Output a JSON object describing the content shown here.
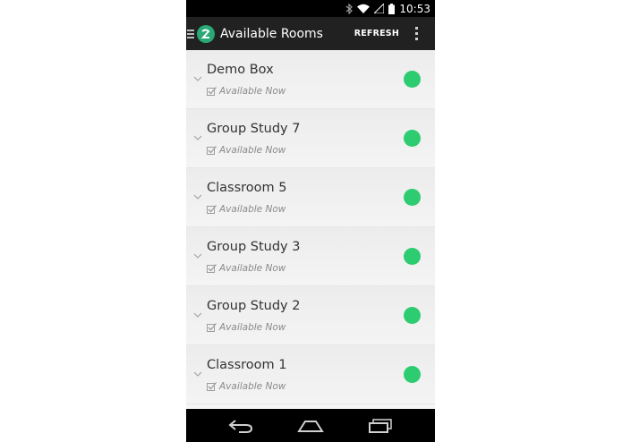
{
  "status_bar": {
    "time": "10:53",
    "icons": [
      "bluetooth-icon",
      "wifi-icon",
      "signal-icon",
      "battery-icon"
    ]
  },
  "action_bar": {
    "title": "Available Rooms",
    "refresh_label": "REFRESH",
    "icons": [
      "drawer-icon",
      "app-logo",
      "overflow-menu-icon"
    ]
  },
  "rooms": [
    {
      "name": "Demo Box",
      "status": "Available Now"
    },
    {
      "name": "Group Study 7",
      "status": "Available Now"
    },
    {
      "name": "Classroom 5",
      "status": "Available Now"
    },
    {
      "name": "Group Study 3",
      "status": "Available Now"
    },
    {
      "name": "Group Study 2",
      "status": "Available Now"
    },
    {
      "name": "Classroom 1",
      "status": "Available Now"
    }
  ],
  "colors": {
    "available": "#2ecc71",
    "action_bar": "#212121",
    "logo": "#2aa876"
  },
  "nav_bar": {
    "icons": [
      "back-icon",
      "home-icon",
      "recents-icon"
    ]
  }
}
